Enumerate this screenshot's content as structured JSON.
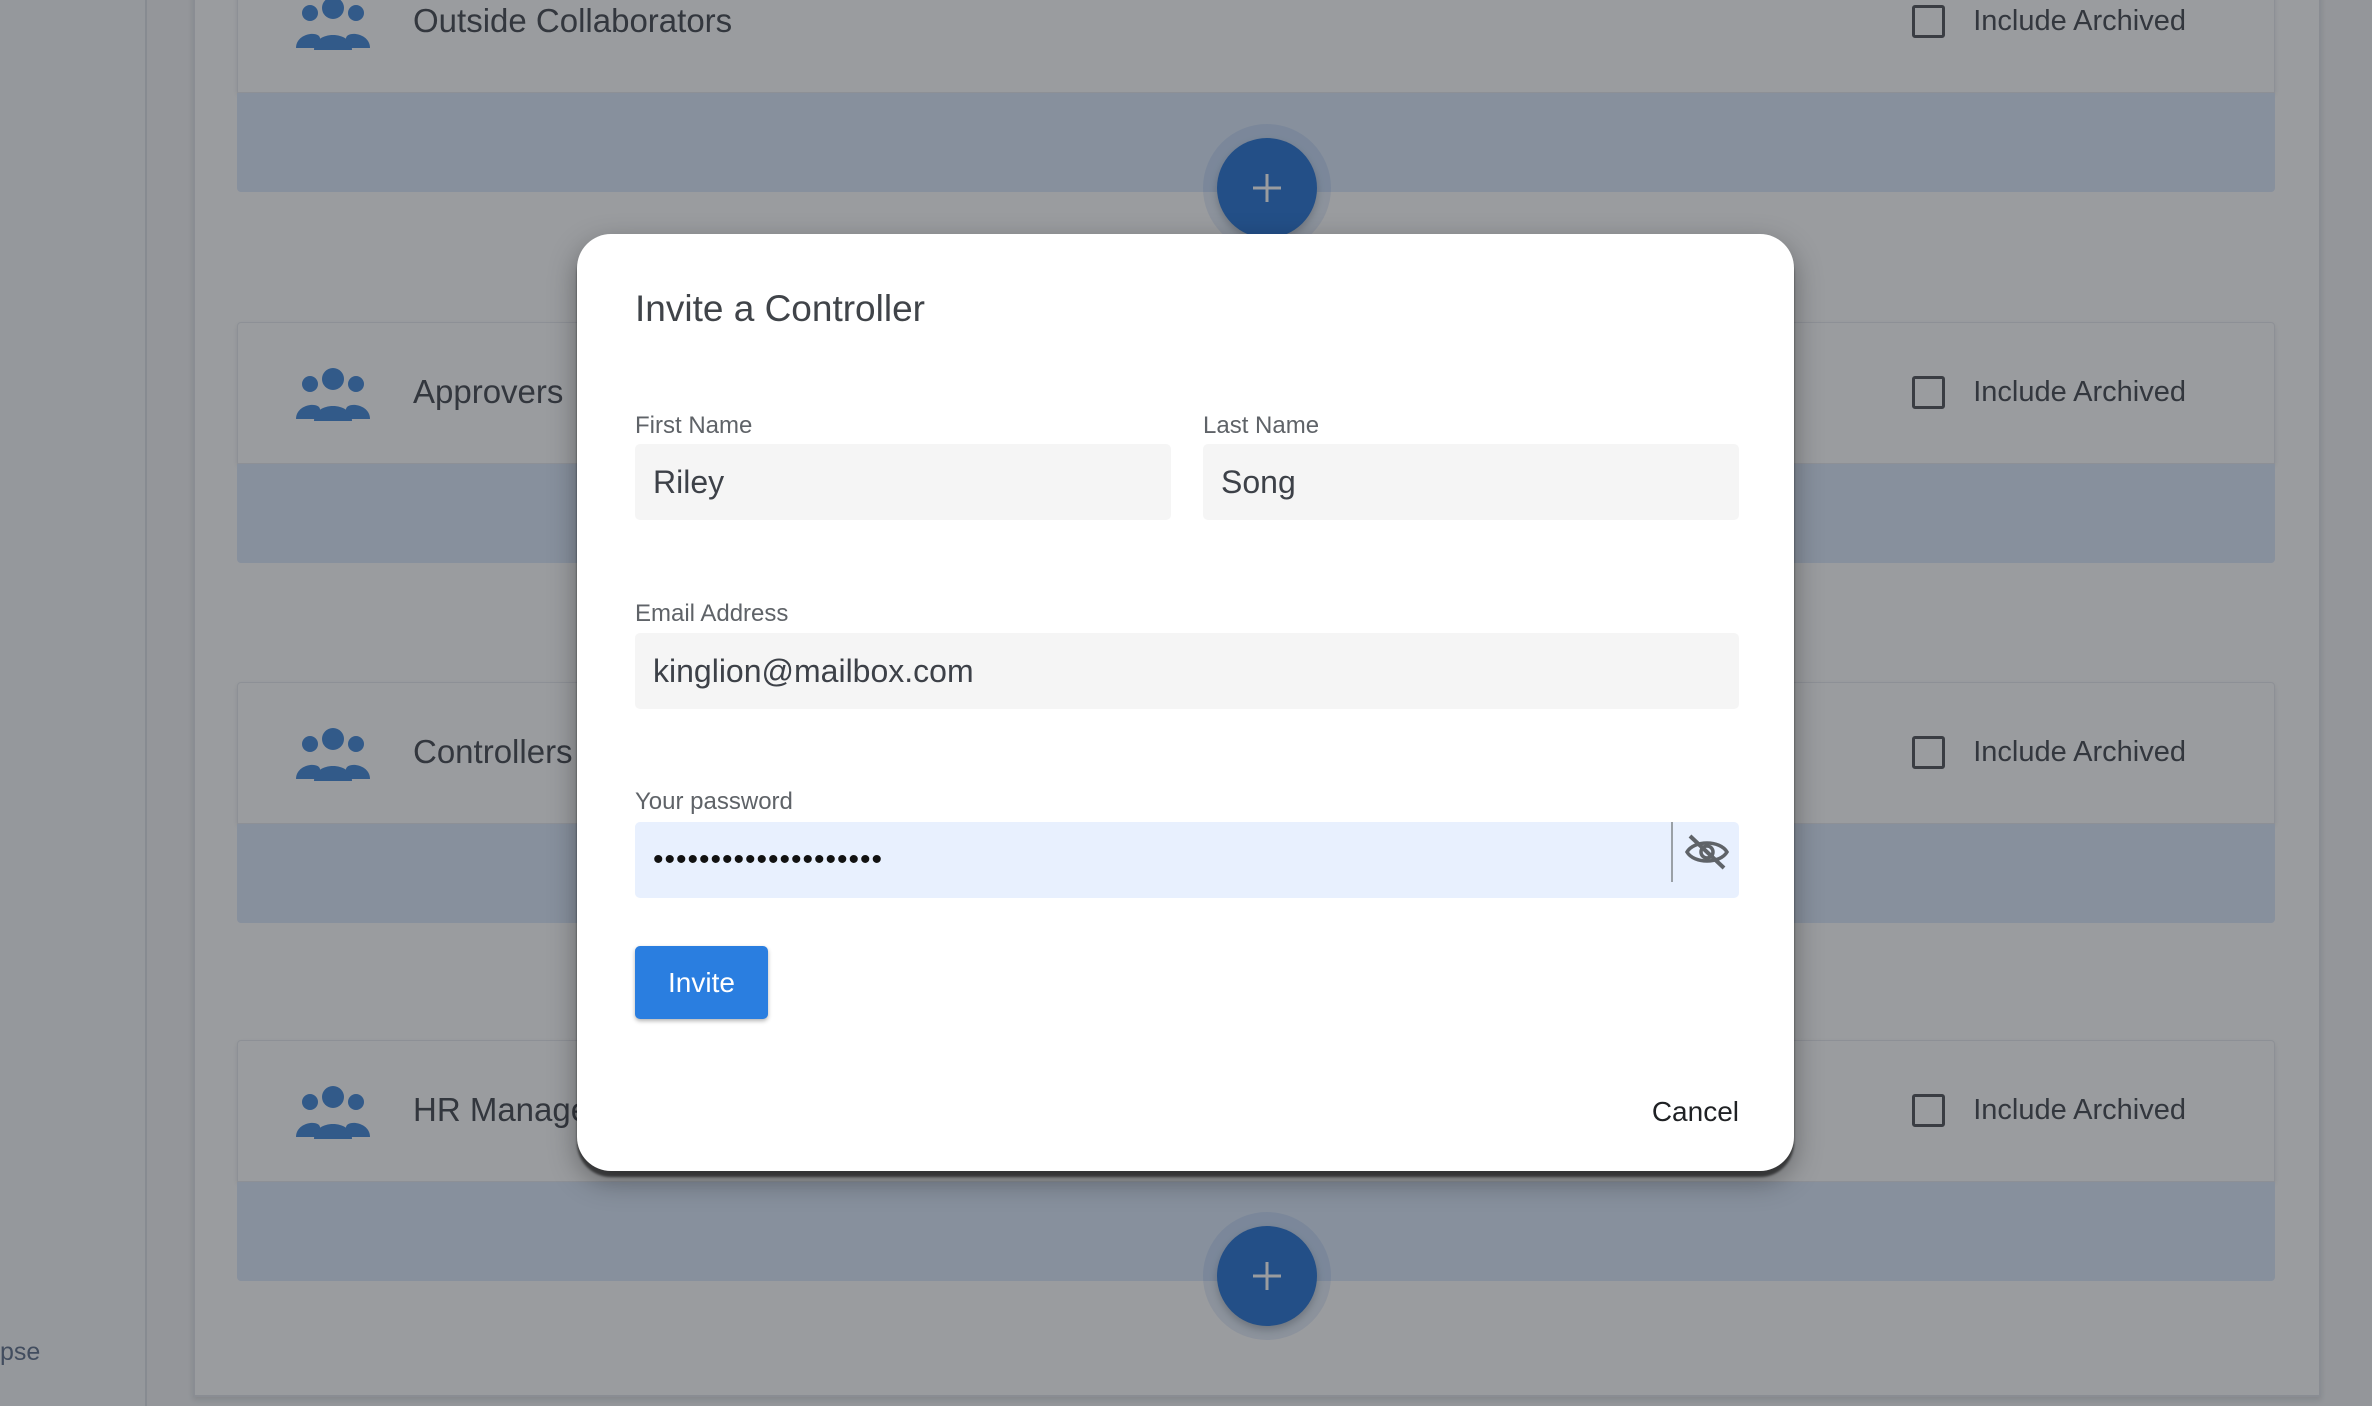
{
  "sidebar": {
    "collapse_label": "pse"
  },
  "groups": [
    {
      "title": "Outside Collaborators",
      "archive_label": "Include Archived"
    },
    {
      "title": "Approvers",
      "archive_label": "Include Archived"
    },
    {
      "title": "Controllers",
      "archive_label": "Include Archived"
    },
    {
      "title": "HR Managers",
      "archive_label": "Include Archived"
    }
  ],
  "icons": {
    "group": "people-group-icon",
    "add": "plus-icon",
    "visibility": "eye-off-icon"
  },
  "dialog": {
    "title": "Invite a Controller",
    "first_name": {
      "label": "First Name",
      "value": "Riley"
    },
    "last_name": {
      "label": "Last Name",
      "value": "Song"
    },
    "email": {
      "label": "Email Address",
      "value": "kinglion@mailbox.com"
    },
    "password": {
      "label": "Your password",
      "value": "••••••••••••••••••••"
    },
    "invite_label": "Invite",
    "cancel_label": "Cancel"
  },
  "colors": {
    "primary": "#2a7ee0",
    "fab": "#1f6fd1",
    "group_icon": "#3b82d6",
    "group_body": "#dbe8fb"
  }
}
